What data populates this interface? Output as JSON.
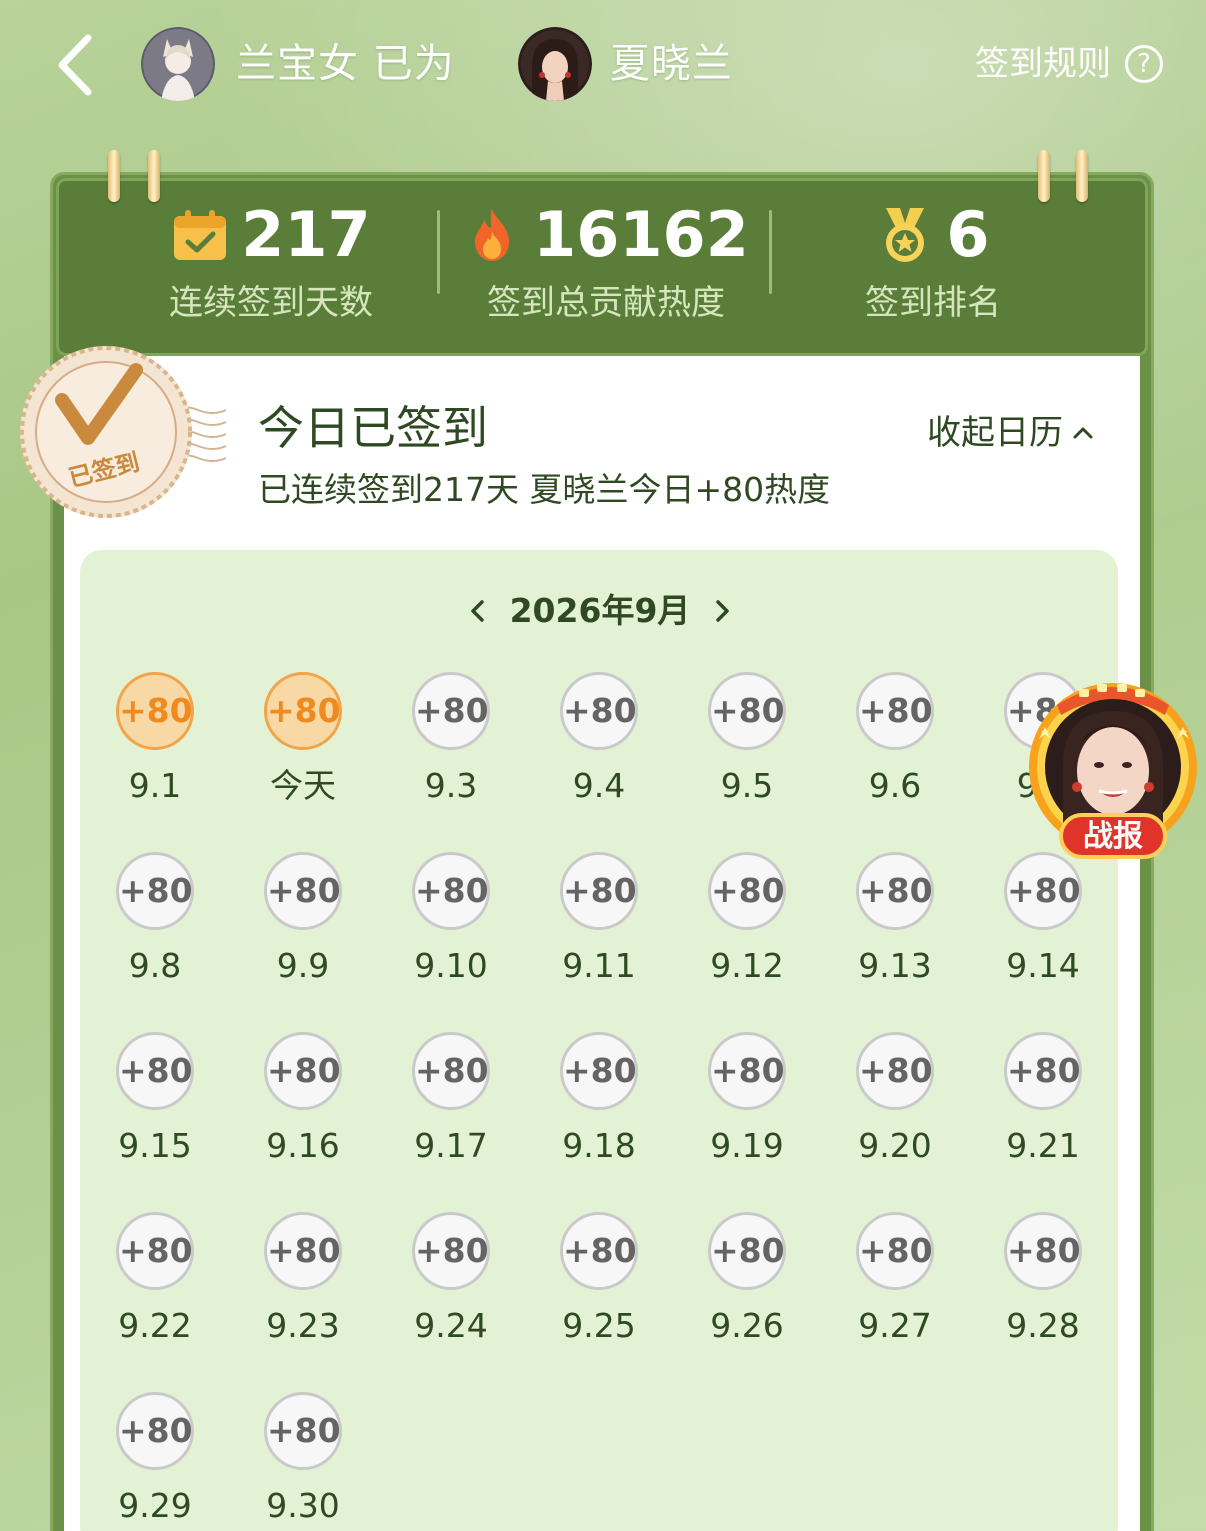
{
  "header": {
    "user_name": "兰宝女 已为",
    "idol_name": "夏晓兰",
    "rules_label": "签到规则",
    "help_glyph": "?"
  },
  "stats": [
    {
      "value": "217",
      "label": "连续签到天数",
      "icon": "calendar-check-icon"
    },
    {
      "value": "16162",
      "label": "签到总贡献热度",
      "icon": "flame-icon"
    },
    {
      "value": "6",
      "label": "签到排名",
      "icon": "medal-icon"
    }
  ],
  "stamp_text": "已签到",
  "checkin": {
    "title": "今日已签到",
    "subtitle": "已连续签到217天 夏晓兰今日+80热度",
    "collapse_label": "收起日历"
  },
  "calendar": {
    "month_label": "2026年9月",
    "days": [
      {
        "points": "+80",
        "label": "9.1",
        "done": true
      },
      {
        "points": "+80",
        "label": "今天",
        "done": true
      },
      {
        "points": "+80",
        "label": "9.3",
        "done": false
      },
      {
        "points": "+80",
        "label": "9.4",
        "done": false
      },
      {
        "points": "+80",
        "label": "9.5",
        "done": false
      },
      {
        "points": "+80",
        "label": "9.6",
        "done": false
      },
      {
        "points": "+80",
        "label": "9.7",
        "done": false
      },
      {
        "points": "+80",
        "label": "9.8",
        "done": false
      },
      {
        "points": "+80",
        "label": "9.9",
        "done": false
      },
      {
        "points": "+80",
        "label": "9.10",
        "done": false
      },
      {
        "points": "+80",
        "label": "9.11",
        "done": false
      },
      {
        "points": "+80",
        "label": "9.12",
        "done": false
      },
      {
        "points": "+80",
        "label": "9.13",
        "done": false
      },
      {
        "points": "+80",
        "label": "9.14",
        "done": false
      },
      {
        "points": "+80",
        "label": "9.15",
        "done": false
      },
      {
        "points": "+80",
        "label": "9.16",
        "done": false
      },
      {
        "points": "+80",
        "label": "9.17",
        "done": false
      },
      {
        "points": "+80",
        "label": "9.18",
        "done": false
      },
      {
        "points": "+80",
        "label": "9.19",
        "done": false
      },
      {
        "points": "+80",
        "label": "9.20",
        "done": false
      },
      {
        "points": "+80",
        "label": "9.21",
        "done": false
      },
      {
        "points": "+80",
        "label": "9.22",
        "done": false
      },
      {
        "points": "+80",
        "label": "9.23",
        "done": false
      },
      {
        "points": "+80",
        "label": "9.24",
        "done": false
      },
      {
        "points": "+80",
        "label": "9.25",
        "done": false
      },
      {
        "points": "+80",
        "label": "9.26",
        "done": false
      },
      {
        "points": "+80",
        "label": "9.27",
        "done": false
      },
      {
        "points": "+80",
        "label": "9.28",
        "done": false
      },
      {
        "points": "+80",
        "label": "9.29",
        "done": false
      },
      {
        "points": "+80",
        "label": "9.30",
        "done": false
      }
    ]
  },
  "report_badge_label": "战报",
  "colors": {
    "board_green": "#5a7e39",
    "calendar_bg": "#e3f2d5",
    "done_orange": "#f08a1f",
    "text_dark_green": "#2f4a22"
  }
}
